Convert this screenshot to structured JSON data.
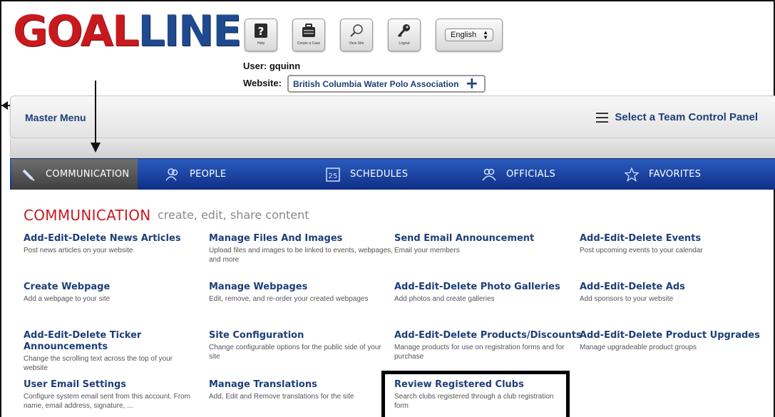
{
  "header": {
    "logo_part1": "GOAL",
    "logo_part2": "LINE",
    "tools": [
      {
        "label": "Help",
        "icon": "help-icon"
      },
      {
        "label": "Create a Case",
        "icon": "briefcase-icon"
      },
      {
        "label": "View Site",
        "icon": "magnifier-icon"
      },
      {
        "label": "Logout",
        "icon": "key-icon"
      }
    ],
    "language": "English",
    "user_label": "User: gquinn",
    "website_label": "Website:",
    "website_value": "British Columbia Water Polo Association",
    "website_add": "+"
  },
  "master": {
    "title": "Master Menu",
    "team_panel": "Select a Team Control Panel"
  },
  "tabs": [
    {
      "label": "COMMUNICATION",
      "icon": "pencil-icon",
      "active": true
    },
    {
      "label": "PEOPLE",
      "icon": "people-icon",
      "active": false
    },
    {
      "label": "SCHEDULES",
      "icon": "calendar-icon",
      "active": false
    },
    {
      "label": "OFFICIALS",
      "icon": "officials-icon",
      "active": false
    },
    {
      "label": "FAVORITES",
      "icon": "star-icon",
      "active": false
    }
  ],
  "calendar_day": "25",
  "section": {
    "title": "COMMUNICATION",
    "subtitle": "create, edit, share content"
  },
  "items": [
    {
      "title": "Add-Edit-Delete News Articles",
      "desc": "Post news articles on your website"
    },
    {
      "title": "Manage Files And Images",
      "desc": "Upload files and images to be linked to events, webpages, and more"
    },
    {
      "title": "Send Email Announcement",
      "desc": "Email your members"
    },
    {
      "title": "Add-Edit-Delete Events",
      "desc": "Post upcoming events to your calendar"
    },
    {
      "title": "Create Webpage",
      "desc": "Add a webpage to your site"
    },
    {
      "title": "Manage Webpages",
      "desc": "Edit, remove, and re-order your created webpages"
    },
    {
      "title": "Add-Edit-Delete Photo Galleries",
      "desc": "Add photos and create galleries"
    },
    {
      "title": "Add-Edit-Delete Ads",
      "desc": "Add sponsors to your website"
    },
    {
      "title": "Add-Edit-Delete Ticker Announcements",
      "desc": "Change the scrolling text across the top of your website"
    },
    {
      "title": "Site Configuration",
      "desc": "Change configurable options for the public side of your site"
    },
    {
      "title": "Add-Edit-Delete Products/Discounts",
      "desc": "Manage products for use on registration forms and for purchase"
    },
    {
      "title": "Add-Edit-Delete Product Upgrades",
      "desc": "Manage upgradeable product groups"
    },
    {
      "title": "User Email Settings",
      "desc": "Configure system email sent from this account. From name, email address, signature, ..."
    },
    {
      "title": "Manage Translations",
      "desc": "Add, Edit and Remove translations for the site"
    },
    {
      "title": "Review Registered Clubs",
      "desc": "Search clubs registered through a club registration form"
    }
  ]
}
